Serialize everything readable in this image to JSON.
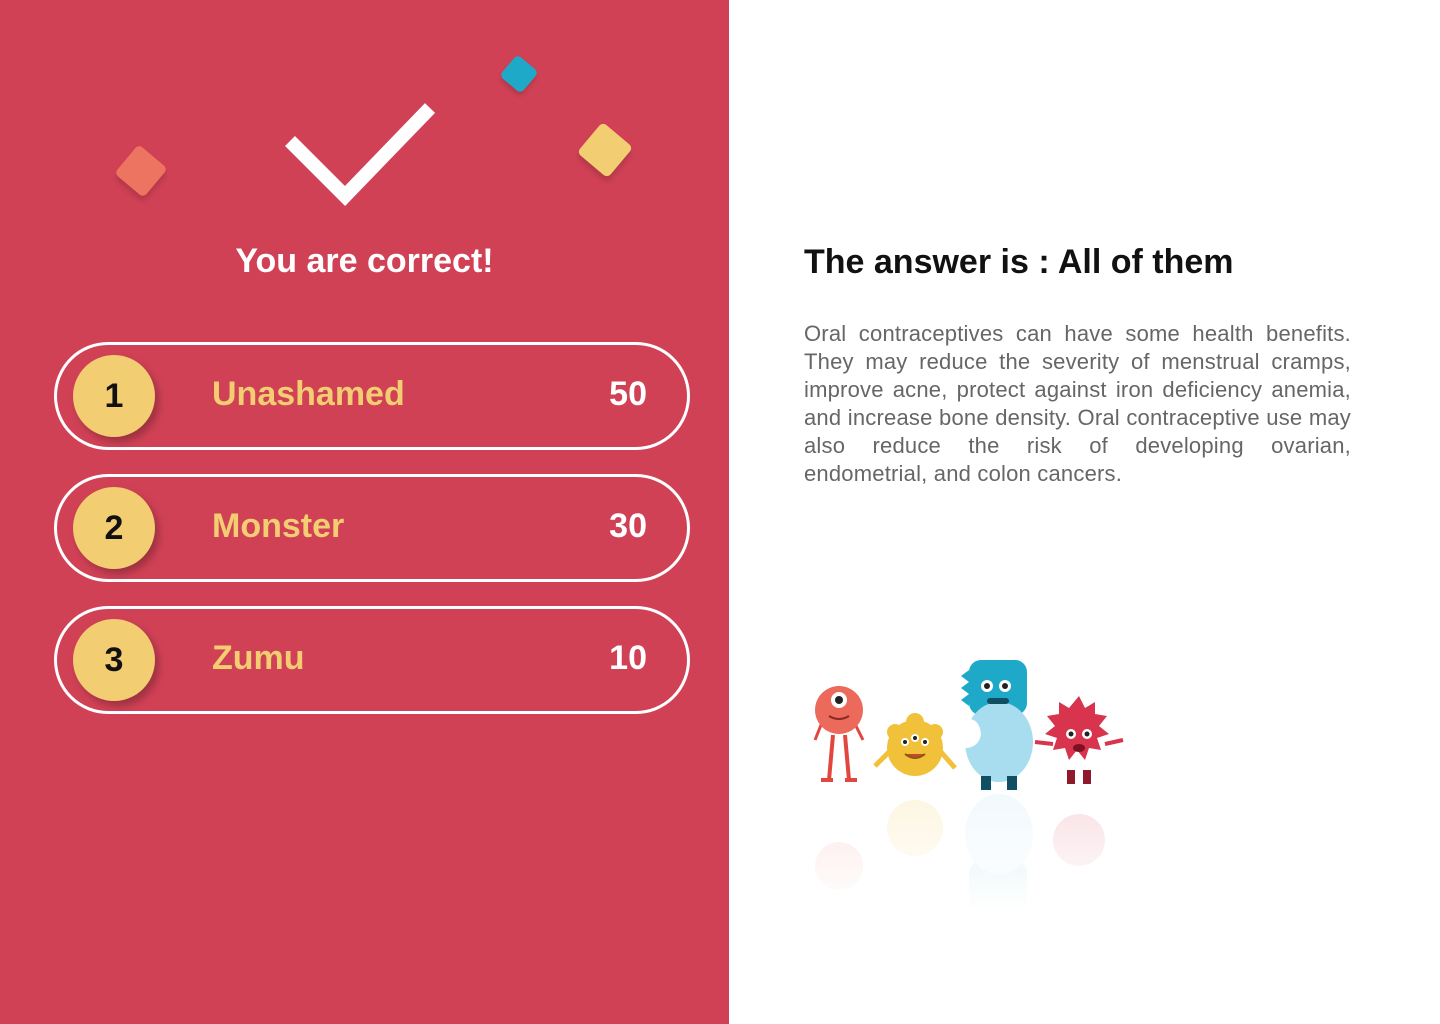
{
  "result": {
    "title": "You are correct!"
  },
  "leaderboard": [
    {
      "rank": "1",
      "name": "Unashamed",
      "score": "50"
    },
    {
      "rank": "2",
      "name": "Monster",
      "score": "30"
    },
    {
      "rank": "3",
      "name": "Zumu",
      "score": "10"
    }
  ],
  "answer": {
    "title": "The answer is : All of them",
    "explanation": "Oral contraceptives can have some health benefits. They may reduce the severity of menstrual cramps, improve acne, protect against iron deficiency anemia, and increase bone density. Oral contraceptive use may also reduce the risk of developing ovarian, endometrial, and colon cancers."
  },
  "icons": {
    "checkmark": "checkmark-icon",
    "confetti": [
      "confetti-shape",
      "confetti-shape",
      "confetti-shape"
    ],
    "illustration": "monsters-illustration"
  },
  "colors": {
    "panel_bg": "#d14156",
    "accent_yellow": "#f2cd72",
    "accent_blue": "#1fa9c9",
    "accent_coral": "#ec7461",
    "text_dark": "#111111",
    "text_gray": "#666666"
  }
}
